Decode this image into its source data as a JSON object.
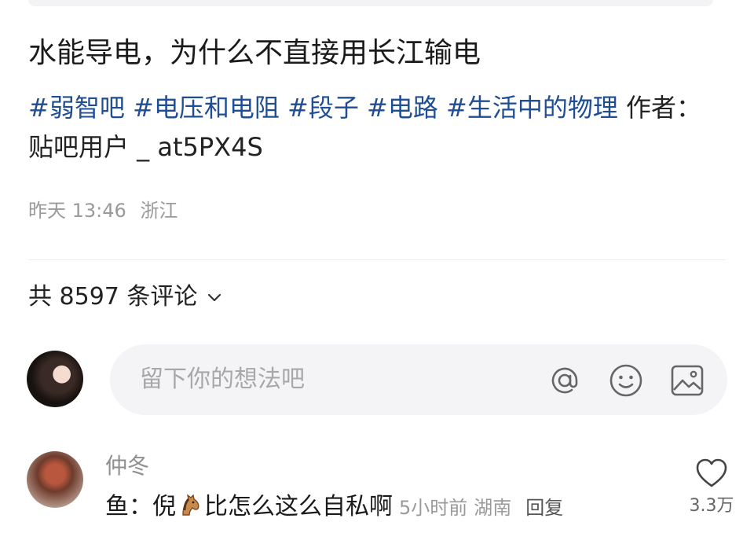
{
  "post": {
    "title": "水能导电，为什么不直接用长江输电",
    "tags": [
      "#弱智吧",
      "#电压和电阻",
      "#段子",
      "#电路",
      "#生活中的物理"
    ],
    "author_prefix": "作者：",
    "author": "贴吧用户 _ at5PX4S",
    "time": "昨天 13:46",
    "location": "浙江"
  },
  "comments_header": {
    "label": "共 8597 条评论",
    "icon": "chevron-down-icon"
  },
  "comment_input": {
    "placeholder": "留下你的想法吧",
    "icons": [
      "at-icon",
      "emoji-icon",
      "image-icon"
    ]
  },
  "comments": [
    {
      "user": "仲冬",
      "text_before": "鱼：倪",
      "emoji": "horse-emoji",
      "text_after": "比怎么这么自私啊",
      "time": "5小时前",
      "location": "湖南",
      "reply_label": "回复",
      "likes": "3.3万"
    }
  ],
  "colors": {
    "tag": "#1f4e95",
    "meta": "#9a9a9a",
    "input_bg": "#f4f4f6"
  }
}
